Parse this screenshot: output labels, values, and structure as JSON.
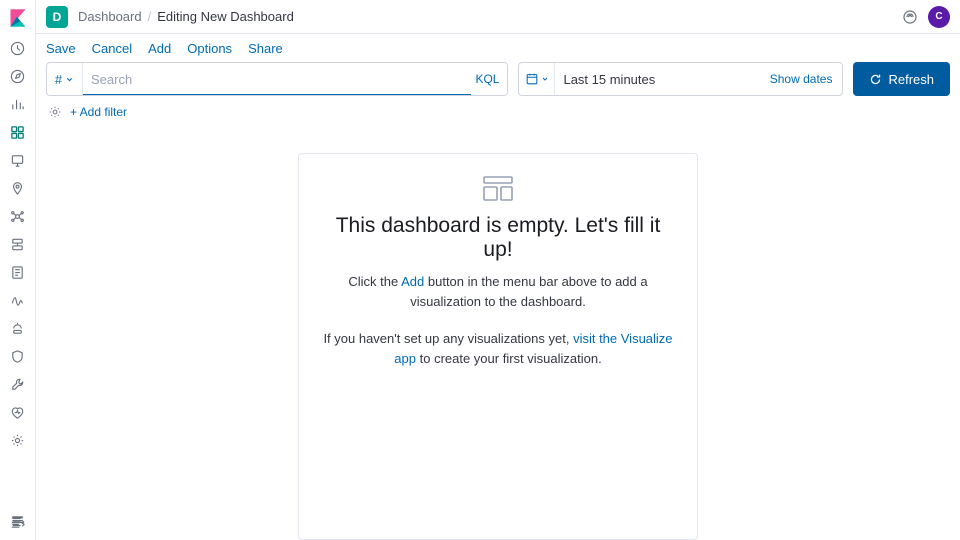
{
  "header": {
    "app_badge_letter": "D",
    "breadcrumb_root": "Dashboard",
    "breadcrumb_current": "Editing New Dashboard",
    "avatar_letter": "C"
  },
  "actions": {
    "save": "Save",
    "cancel": "Cancel",
    "add": "Add",
    "options": "Options",
    "share": "Share"
  },
  "query": {
    "filter_symbol": "#",
    "search_placeholder": "Search",
    "kql_label": "KQL",
    "date_text": "Last 15 minutes",
    "show_dates": "Show dates",
    "refresh_label": "Refresh"
  },
  "filter_bar": {
    "add_filter": "+ Add filter"
  },
  "empty_state": {
    "title": "This dashboard is empty. Let's fill it up!",
    "line1_a": "Click the ",
    "line1_link": "Add",
    "line1_b": " button in the menu bar above to add a visualization to the dashboard.",
    "line2_a": "If you haven't set up any visualizations yet, ",
    "line2_link": "visit the Visualize app",
    "line2_b": " to create your first visualization."
  },
  "sidebar": {
    "items": [
      "recent",
      "discover",
      "visualize",
      "dashboard",
      "canvas",
      "maps",
      "machine-learning",
      "infrastructure",
      "logs",
      "apm",
      "uptime",
      "siem",
      "dev-tools",
      "stack-monitoring",
      "management"
    ]
  }
}
